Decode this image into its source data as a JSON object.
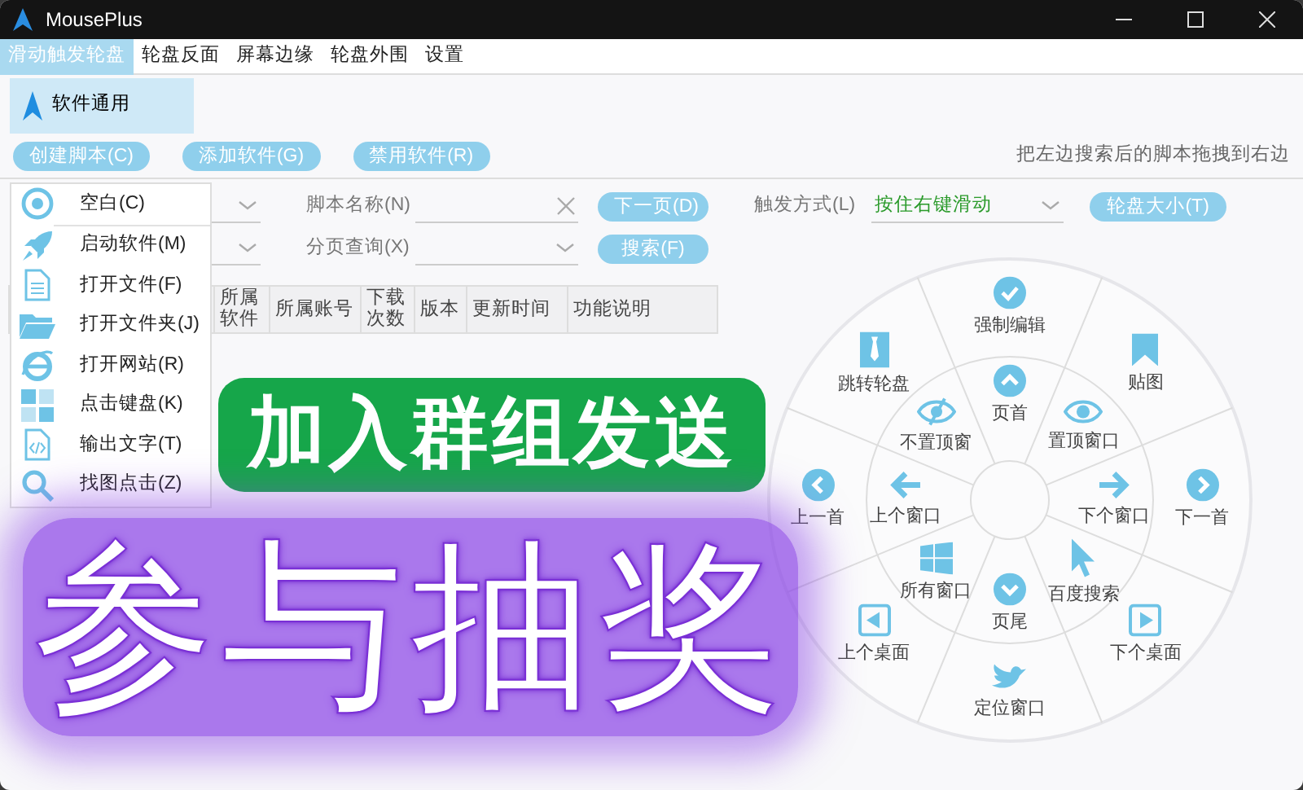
{
  "window": {
    "title": "MousePlus"
  },
  "tabs": [
    {
      "label": "滑动触发轮盘",
      "selected": true
    },
    {
      "label": "轮盘反面",
      "selected": false
    },
    {
      "label": "屏幕边缘",
      "selected": false
    },
    {
      "label": "轮盘外围",
      "selected": false
    },
    {
      "label": "设置",
      "selected": false
    }
  ],
  "sidebar": {
    "items": [
      {
        "label": "软件通用",
        "selected": true
      }
    ]
  },
  "action_buttons": [
    "创建脚本(C)",
    "添加软件(G)",
    "禁用软件(R)"
  ],
  "hint": "把左边搜索后的脚本拖拽到右边",
  "filters": {
    "script_name_label": "脚本名称(N)",
    "paging_label": "分页查询(X)",
    "next_button": "下一页(D)",
    "search_button": "搜索(F)"
  },
  "table": {
    "columns": [
      "所属软件",
      "所属账号",
      "下载次数",
      "版本",
      "更新时间",
      "功能说明"
    ]
  },
  "trigger": {
    "label": "触发方式(L)",
    "value": "按住右键滑动",
    "size_button": "轮盘大小(T)"
  },
  "action_menu": {
    "items": [
      {
        "label": "空白(C)"
      },
      {
        "label": "启动软件(M)"
      },
      {
        "label": "打开文件(F)"
      },
      {
        "label": "打开文件夹(J)"
      },
      {
        "label": "打开网站(R)"
      },
      {
        "label": "点击键盘(K)"
      },
      {
        "label": "输出文字(T)"
      },
      {
        "label": "找图点击(Z)"
      }
    ]
  },
  "wheel": {
    "outer": [
      {
        "label": "强制编辑",
        "kind": "north"
      },
      {
        "label": "跳转轮盘",
        "kind": "northwest"
      },
      {
        "label": "贴图",
        "kind": "northeast"
      },
      {
        "label": "上一首",
        "kind": "west"
      },
      {
        "label": "下一首",
        "kind": "east"
      },
      {
        "label": "上个桌面",
        "kind": "southwest"
      },
      {
        "label": "下个桌面",
        "kind": "southeast"
      },
      {
        "label": "定位窗口",
        "kind": "south"
      }
    ],
    "inner": [
      {
        "label": "页首",
        "kind": "north"
      },
      {
        "label": "不置顶窗",
        "kind": "northwest"
      },
      {
        "label": "置顶窗口",
        "kind": "northeast"
      },
      {
        "label": "上个窗口",
        "kind": "west"
      },
      {
        "label": "下个窗口",
        "kind": "east"
      },
      {
        "label": "所有窗口",
        "kind": "southwest"
      },
      {
        "label": "百度搜索",
        "kind": "southeast"
      },
      {
        "label": "页尾",
        "kind": "south"
      }
    ]
  },
  "overlay": {
    "banner": "加入群组发送",
    "headline": "参与抽奖"
  }
}
